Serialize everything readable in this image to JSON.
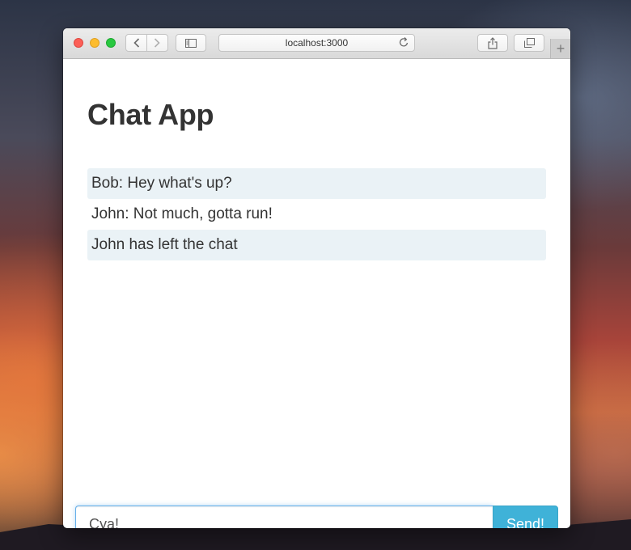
{
  "browser": {
    "url": "localhost:3000"
  },
  "page": {
    "title": "Chat App"
  },
  "messages": [
    {
      "text": "Bob: Hey what's up?"
    },
    {
      "text": "John: Not much, gotta run!"
    },
    {
      "text": "John has left the chat"
    }
  ],
  "composer": {
    "input_value": "Cya!",
    "send_label": "Send!"
  },
  "colors": {
    "accent": "#3fb2d8",
    "message_stripe": "#eaf2f6",
    "title_text": "#333333"
  },
  "icons": {
    "back": "chevron-left-icon",
    "forward": "chevron-right-icon",
    "sidebar": "sidebar-icon",
    "reload": "reload-icon",
    "share": "share-icon",
    "tabs": "tabs-icon",
    "new_tab": "plus-icon"
  }
}
